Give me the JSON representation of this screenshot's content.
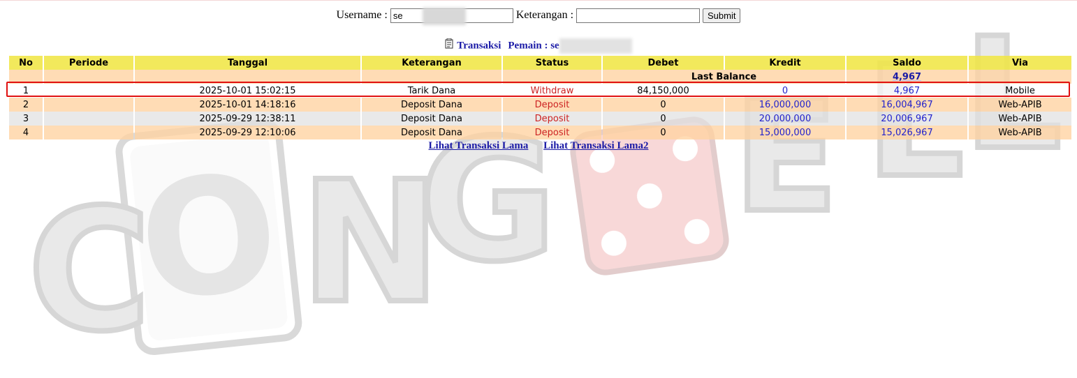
{
  "search": {
    "username_label": "Username :",
    "username_value": "se",
    "keterangan_label": "Keterangan :",
    "keterangan_value": "",
    "submit_label": "Submit"
  },
  "title": {
    "transaksi": "Transaksi",
    "pemain_label": "Pemain : se"
  },
  "table": {
    "headers": [
      "No",
      "Periode",
      "Tanggal",
      "Keterangan",
      "Status",
      "Debet",
      "Kredit",
      "Saldo",
      "Via"
    ],
    "last_balance_label": "Last Balance",
    "last_balance_value": "4,967",
    "rows": [
      {
        "no": "1",
        "periode": "",
        "tanggal": "2025-10-01 15:02:15",
        "keterangan": "Tarik Dana",
        "status": "Withdraw",
        "debet": "84,150,000",
        "kredit": "0",
        "saldo": "4,967",
        "via": "Mobile"
      },
      {
        "no": "2",
        "periode": "",
        "tanggal": "2025-10-01 14:18:16",
        "keterangan": "Deposit Dana",
        "status": "Deposit",
        "debet": "0",
        "kredit": "16,000,000",
        "saldo": "16,004,967",
        "via": "Web-APIB"
      },
      {
        "no": "3",
        "periode": "",
        "tanggal": "2025-09-29 12:38:11",
        "keterangan": "Deposit Dana",
        "status": "Deposit",
        "debet": "0",
        "kredit": "20,000,000",
        "saldo": "20,006,967",
        "via": "Web-APIB"
      },
      {
        "no": "4",
        "periode": "",
        "tanggal": "2025-09-29 12:10:06",
        "keterangan": "Deposit Dana",
        "status": "Deposit",
        "debet": "0",
        "kredit": "15,000,000",
        "saldo": "15,026,967",
        "via": "Web-APIB"
      }
    ]
  },
  "links": {
    "old_tx": "Lihat Transaksi Lama",
    "old_tx2": "Lihat Transaksi Lama2"
  },
  "watermark": {
    "text": "CONG ELL",
    "icons": [
      "playing-card-icon",
      "dice-icon"
    ]
  },
  "colors": {
    "header_yellow": "#F0E646",
    "row_peach": "#FFD2A0",
    "row_gray": "#E1E1E1",
    "link_blue": "#1A1AA6",
    "status_red": "#CC2222",
    "highlight_red": "#E01010"
  }
}
